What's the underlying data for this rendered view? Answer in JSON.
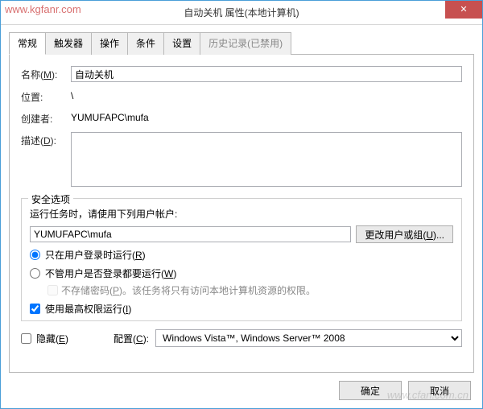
{
  "watermark": "www.kgfanr.com",
  "watermark2": "www.cfan.com.cn",
  "titlebar": {
    "title": "自动关机 属性(本地计算机)",
    "close": "✕"
  },
  "tabs": {
    "items": [
      {
        "label": "常规"
      },
      {
        "label": "触发器"
      },
      {
        "label": "操作"
      },
      {
        "label": "条件"
      },
      {
        "label": "设置"
      },
      {
        "label": "历史记录(已禁用)"
      }
    ]
  },
  "general": {
    "name_label_pre": "名称(",
    "name_label_u": "M",
    "name_label_post": "):",
    "name_value": "自动关机",
    "loc_label": "位置:",
    "loc_value": "\\",
    "creator_label": "创建者:",
    "creator_value": "YUMUFAPC\\mufa",
    "desc_label_pre": "描述(",
    "desc_label_u": "D",
    "desc_label_post": "):",
    "desc_value": ""
  },
  "security": {
    "legend": "安全选项",
    "run_as_label": "运行任务时，请使用下列用户帐户:",
    "user_value": "YUMUFAPC\\mufa",
    "change_btn_pre": "更改用户或组(",
    "change_btn_u": "U",
    "change_btn_post": ")...",
    "radio1_pre": "只在用户登录时运行(",
    "radio1_u": "R",
    "radio1_post": ")",
    "radio2_pre": "不管用户是否登录都要运行(",
    "radio2_u": "W",
    "radio2_post": ")",
    "store_pw_pre": "不存储密码(",
    "store_pw_u": "P",
    "store_pw_post": ")。该任务将只有访问本地计算机资源的权限。",
    "highest_pre": "使用最高权限运行(",
    "highest_u": "I",
    "highest_post": ")"
  },
  "bottom": {
    "hidden_pre": "隐藏(",
    "hidden_u": "E",
    "hidden_post": ")",
    "config_pre": "配置(",
    "config_u": "C",
    "config_post": "):",
    "config_value": "Windows Vista™, Windows Server™ 2008"
  },
  "buttons": {
    "ok": "确定",
    "cancel": "取消"
  }
}
